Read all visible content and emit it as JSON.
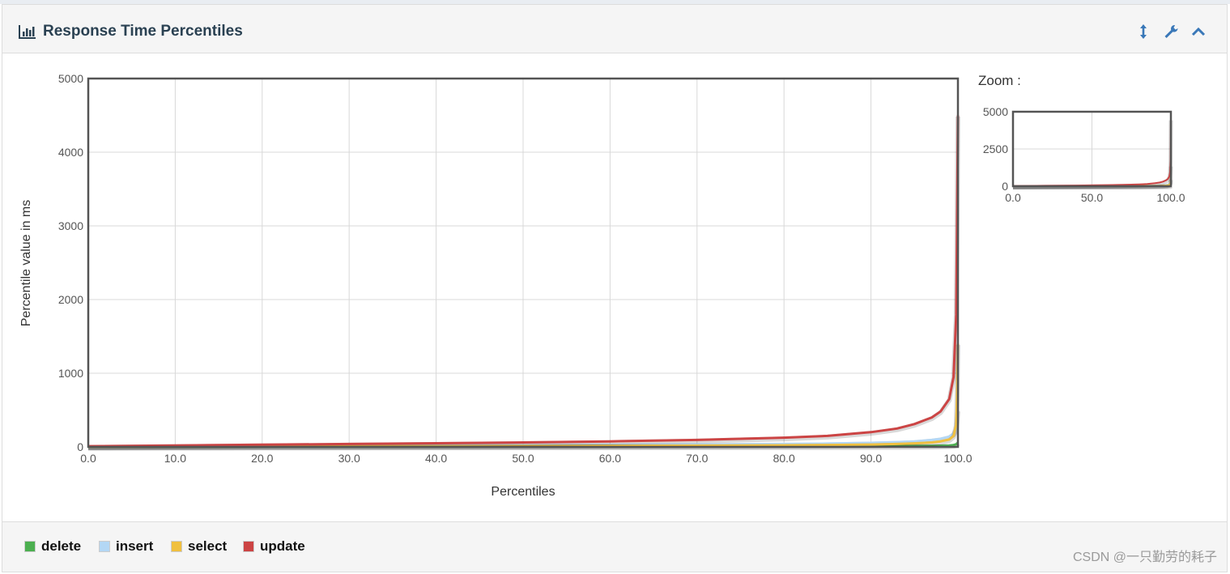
{
  "panel": {
    "title": "Response Time Percentiles"
  },
  "zoom_label": "Zoom :",
  "chart_data": {
    "type": "line",
    "title": "Response Time Percentiles",
    "xlabel": "Percentiles",
    "ylabel": "Percentile value in ms",
    "xlim": [
      0,
      100
    ],
    "ylim": [
      0,
      5000
    ],
    "x_ticks": [
      "0.0",
      "10.0",
      "20.0",
      "30.0",
      "40.0",
      "50.0",
      "60.0",
      "70.0",
      "80.0",
      "90.0",
      "100.0"
    ],
    "y_ticks": [
      "0",
      "1000",
      "2000",
      "3000",
      "4000",
      "5000"
    ],
    "grid": true,
    "legend_position": "bottom",
    "x": [
      0,
      10,
      20,
      30,
      40,
      50,
      60,
      70,
      80,
      85,
      90,
      93,
      95,
      97,
      98,
      99,
      99.5,
      99.8,
      99.9,
      100
    ],
    "series": [
      {
        "name": "delete",
        "color": "#4caf50",
        "values": [
          0,
          1,
          2,
          3,
          4,
          5,
          6,
          7,
          8,
          9,
          10,
          11,
          12,
          14,
          16,
          20,
          25,
          35,
          45,
          60
        ]
      },
      {
        "name": "insert",
        "color": "#b3d7f5",
        "values": [
          5,
          8,
          12,
          15,
          18,
          22,
          27,
          33,
          40,
          45,
          55,
          65,
          75,
          95,
          110,
          140,
          180,
          250,
          350,
          500
        ]
      },
      {
        "name": "select",
        "color": "#f0c040",
        "values": [
          2,
          4,
          6,
          8,
          10,
          12,
          15,
          18,
          22,
          26,
          32,
          40,
          48,
          60,
          75,
          100,
          150,
          300,
          700,
          1400
        ]
      },
      {
        "name": "update",
        "color": "#cc4444",
        "values": [
          10,
          20,
          30,
          40,
          50,
          60,
          75,
          95,
          125,
          150,
          200,
          250,
          310,
          400,
          480,
          650,
          950,
          1800,
          3000,
          4500
        ]
      }
    ],
    "zoom": {
      "xlim": [
        0,
        100
      ],
      "ylim": [
        0,
        5000
      ],
      "x_ticks": [
        "0.0",
        "50.0",
        "100.0"
      ],
      "y_ticks": [
        "0",
        "2500",
        "5000"
      ]
    }
  },
  "watermark": "CSDN @一只勤劳的耗子"
}
